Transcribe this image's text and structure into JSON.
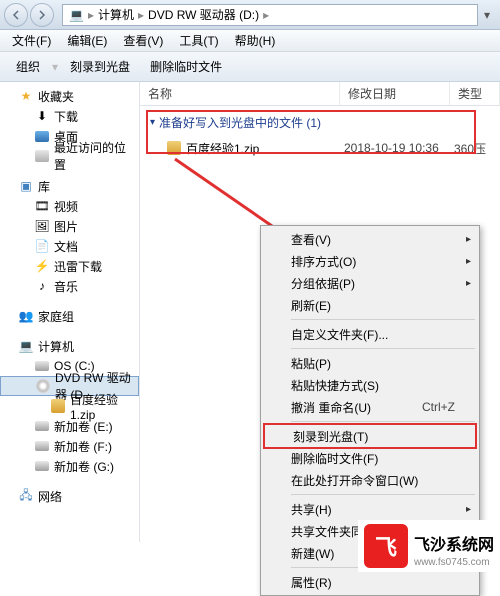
{
  "titlebar": {
    "breadcrumb": {
      "seg1": "计算机",
      "seg2": "DVD RW 驱动器 (D:)"
    }
  },
  "menubar": {
    "file": "文件(F)",
    "edit": "编辑(E)",
    "view": "查看(V)",
    "tools": "工具(T)",
    "help": "帮助(H)"
  },
  "toolbar": {
    "organize": "组织",
    "burn": "刻录到光盘",
    "delete_temp": "删除临时文件"
  },
  "columns": {
    "name": "名称",
    "date": "修改日期",
    "type": "类型"
  },
  "sidebar": {
    "favorites": "收藏夹",
    "downloads": "下载",
    "desktop": "桌面",
    "recent": "最近访问的位置",
    "libraries": "库",
    "videos": "视频",
    "pictures": "图片",
    "documents": "文档",
    "thunder": "迅雷下载",
    "music": "音乐",
    "homegroup": "家庭组",
    "computer": "计算机",
    "os_c": "OS (C:)",
    "dvd": "DVD RW 驱动器 (D",
    "zip": "百度经验1.zip",
    "drive_e": "新加卷 (E:)",
    "drive_f": "新加卷 (F:)",
    "drive_g": "新加卷 (G:)",
    "network": "网络"
  },
  "files": {
    "group_header": "准备好写入到光盘中的文件 (1)",
    "row1": {
      "name": "百度经验1.zip",
      "date": "2018-10-19 10:36",
      "type": "360压"
    }
  },
  "context_menu": {
    "view": "查看(V)",
    "sort": "排序方式(O)",
    "group": "分组依据(P)",
    "refresh": "刷新(E)",
    "customize": "自定义文件夹(F)...",
    "paste": "粘贴(P)",
    "paste_shortcut": "粘贴快捷方式(S)",
    "undo_rename": "撤消 重命名(U)",
    "undo_shortcut": "Ctrl+Z",
    "burn": "刻录到光盘(T)",
    "delete_temp": "删除临时文件(F)",
    "open_cmd": "在此处打开命令窗口(W)",
    "share": "共享(H)",
    "sync": "共享文件夹同步",
    "new": "新建(W)",
    "properties": "属性(R)"
  },
  "watermark": {
    "brand": "飞沙系统网",
    "url": "www.fs0745.com",
    "logo": "飞"
  }
}
